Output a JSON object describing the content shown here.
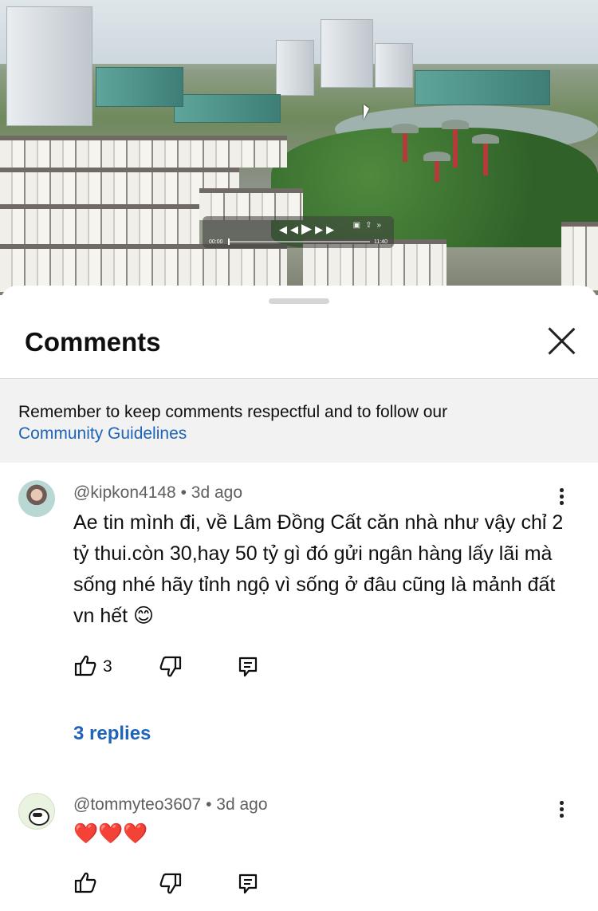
{
  "video": {
    "time_current": "00:00",
    "time_total": "11:40",
    "progress": 0.0
  },
  "sheet": {
    "title": "Comments",
    "notice_text": "Remember to keep comments respectful and to follow our",
    "notice_link": "Community Guidelines"
  },
  "comments": [
    {
      "author": "@kipkon4148",
      "age": "3d ago",
      "text": "Ae tin mình đi, về Lâm Đồng Cất căn nhà như vậy chỉ 2 tỷ thui.còn 30,hay 50 tỷ gì đó gửi ngân hàng lấy lãi mà sống nhé hãy tỉnh ngộ vì sống ở đâu cũng là mảnh đất vn hết 😊",
      "likes": "3",
      "replies_label": "3 replies"
    },
    {
      "author": "@tommyteo3607",
      "age": "3d ago",
      "text": "❤️❤️❤️"
    }
  ],
  "icons": {
    "like": "thumbs-up-icon",
    "dislike": "thumbs-down-icon",
    "reply": "reply-icon",
    "more": "more-vertical-icon",
    "close": "close-icon"
  },
  "colors": {
    "link": "#1f64b8",
    "notice_bg": "#f2f2f2",
    "meta": "#606060"
  }
}
